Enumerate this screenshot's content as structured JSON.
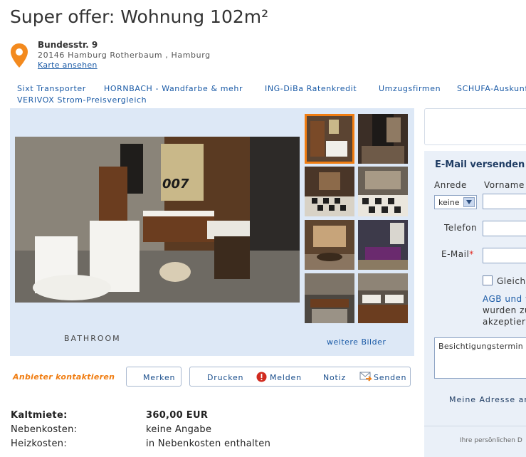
{
  "listing": {
    "title": "Super offer: Wohnung 102m²",
    "street": "Bundesstr. 9",
    "city_line": "20146 Hamburg Rotherbaum , Hamburg",
    "map_link": "Karte ansehen"
  },
  "ad_links": [
    "Sixt Transporter",
    "HORNBACH - Wandfarbe & mehr",
    "ING-DiBa Ratenkredit",
    "Umzugsfirmen",
    "SCHUFA-Auskunft",
    "VERIVOX Strom-Preisvergleich"
  ],
  "gallery": {
    "caption": "BATHROOM",
    "more_link": "weitere Bilder",
    "thumb_count": 8
  },
  "actions": {
    "contact": "Anbieter kontaktieren",
    "save": "Merken",
    "print": "Drucken",
    "report": "Melden",
    "note": "Notiz",
    "send": "Senden"
  },
  "facts": [
    {
      "key": "Kaltmiete:",
      "value": "360,00 EUR",
      "bold": true
    },
    {
      "key": "Nebenkosten:",
      "value": "keine Angabe",
      "bold": false
    },
    {
      "key": "Heizkosten:",
      "value": "in Nebenkosten enthalten",
      "bold": false
    }
  ],
  "email_form": {
    "heading": "E-Mail versenden",
    "salutation_label": "Anrede",
    "salutation_value": "keine",
    "firstname_label": "Vorname",
    "phone_label": "Telefon",
    "email_label": "E-Mail",
    "required_mark": "*",
    "checkbox_label": "Gleichz",
    "agb_line1": "AGB und w",
    "agb_line2": "wurden zu",
    "agb_line3": "akzeptiert",
    "message_value": "Besichtigungstermin",
    "my_address": "Meine Adresse an",
    "footer": "Ihre persönlichen D"
  },
  "colors": {
    "link": "#1a5aa6",
    "accent": "#f07d12",
    "panel": "#eaf0f8",
    "gallery_bg": "#dde8f6"
  }
}
